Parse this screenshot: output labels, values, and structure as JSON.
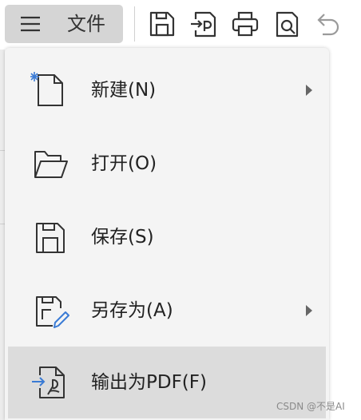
{
  "toolbar": {
    "file_menu_label": "文件",
    "icons": [
      "save-icon",
      "export-icon",
      "print-icon",
      "print-preview-icon",
      "undo-icon"
    ]
  },
  "menu": {
    "items": [
      {
        "label": "新建(N)",
        "icon": "new-file-icon",
        "has_submenu": true
      },
      {
        "label": "打开(O)",
        "icon": "folder-open-icon",
        "has_submenu": false
      },
      {
        "label": "保存(S)",
        "icon": "save-icon",
        "has_submenu": false
      },
      {
        "label": "另存为(A)",
        "icon": "save-as-icon",
        "has_submenu": true
      },
      {
        "label": "输出为PDF(F)",
        "icon": "export-pdf-icon",
        "has_submenu": false,
        "hovered": true
      }
    ]
  },
  "watermark": "CSDN @不是AI",
  "colors": {
    "menu_bg": "#f4f4f4",
    "hover_bg": "#dcdcdc",
    "file_button_bg": "#d5d5d5",
    "accent_blue": "#3a7bd5"
  }
}
